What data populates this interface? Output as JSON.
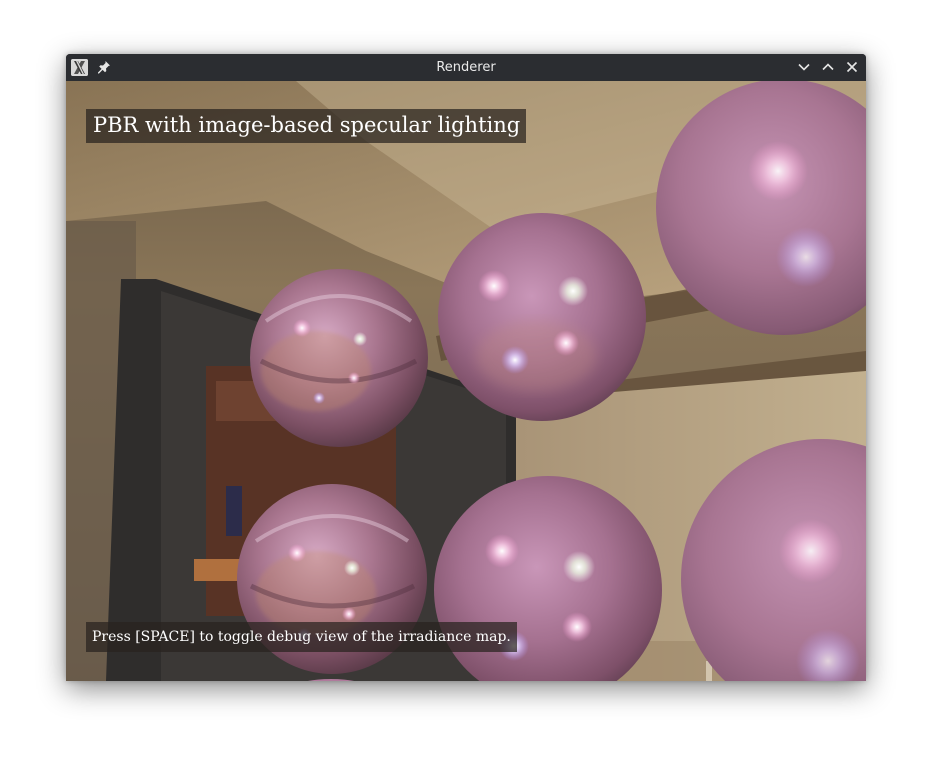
{
  "window": {
    "title": "Renderer"
  },
  "overlay": {
    "heading": "PBR with image-based specular lighting",
    "hint": "Press [SPACE] to toggle debug view of the irradiance map."
  },
  "titlebar_buttons": [
    "minimize",
    "maximize",
    "close"
  ],
  "colors": {
    "titlebar": "#2b2d31",
    "sphere_tint": "#b07a9c",
    "overlay_bg": "#28221e"
  }
}
